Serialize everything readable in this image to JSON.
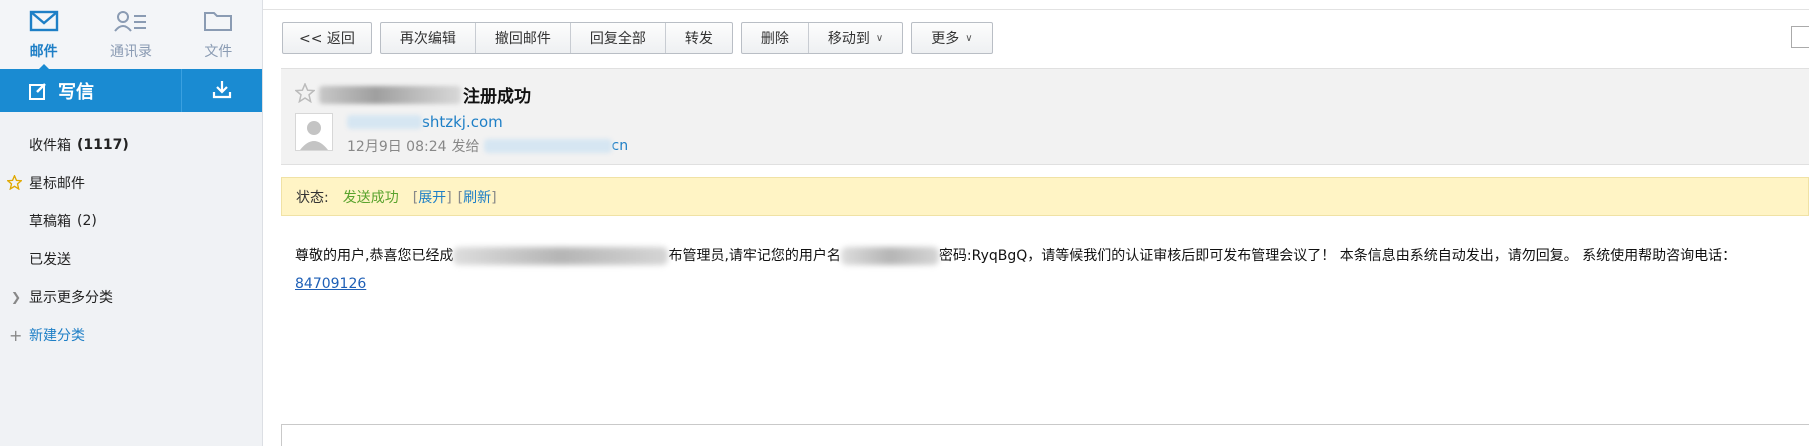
{
  "nav": {
    "items": [
      {
        "label": "邮件",
        "icon": "mail-icon",
        "active": true
      },
      {
        "label": "通讯录",
        "icon": "contacts-icon",
        "active": false
      },
      {
        "label": "文件",
        "icon": "folder-icon",
        "active": false
      }
    ]
  },
  "compose": {
    "label": "写信",
    "icon": "compose-icon",
    "download_icon": "download-icon"
  },
  "folders": {
    "inbox": {
      "label": "收件箱",
      "count": "(1117)"
    },
    "starred": {
      "label": "星标邮件"
    },
    "drafts": {
      "label": "草稿箱",
      "count": "(2)"
    },
    "sent": {
      "label": "已发送"
    },
    "more": {
      "label": "显示更多分类"
    },
    "new_category": {
      "label": "新建分类"
    }
  },
  "toolbar": {
    "back": "<< 返回",
    "edit_again": "再次编辑",
    "recall": "撤回邮件",
    "reply_all": "回复全部",
    "forward": "转发",
    "delete": "删除",
    "move_to": "移动到",
    "more": "更多"
  },
  "mail": {
    "subject_suffix": "注册成功",
    "sender_suffix": "shtzkj.com",
    "date": "12月9日 08:24",
    "sent_to_label": "发给",
    "recipient_suffix": "cn"
  },
  "status": {
    "label": "状态:",
    "value": "发送成功",
    "expand": "展开",
    "refresh": "刷新",
    "success_color": "#5aa32e"
  },
  "body": {
    "part1": "尊敬的用户,恭喜您已经成",
    "part2": "布管理员,请牢记您的用户名",
    "part3": "密码:RyqBgQ，请等候我们的认证审核后即可发布管理会议了！ 本条信息由系统自动发出，请勿回复。 系统使用帮助咨询电话：",
    "phone": "84709126"
  },
  "colors": {
    "accent": "#1a8bd2",
    "link": "#1e7fc6"
  }
}
